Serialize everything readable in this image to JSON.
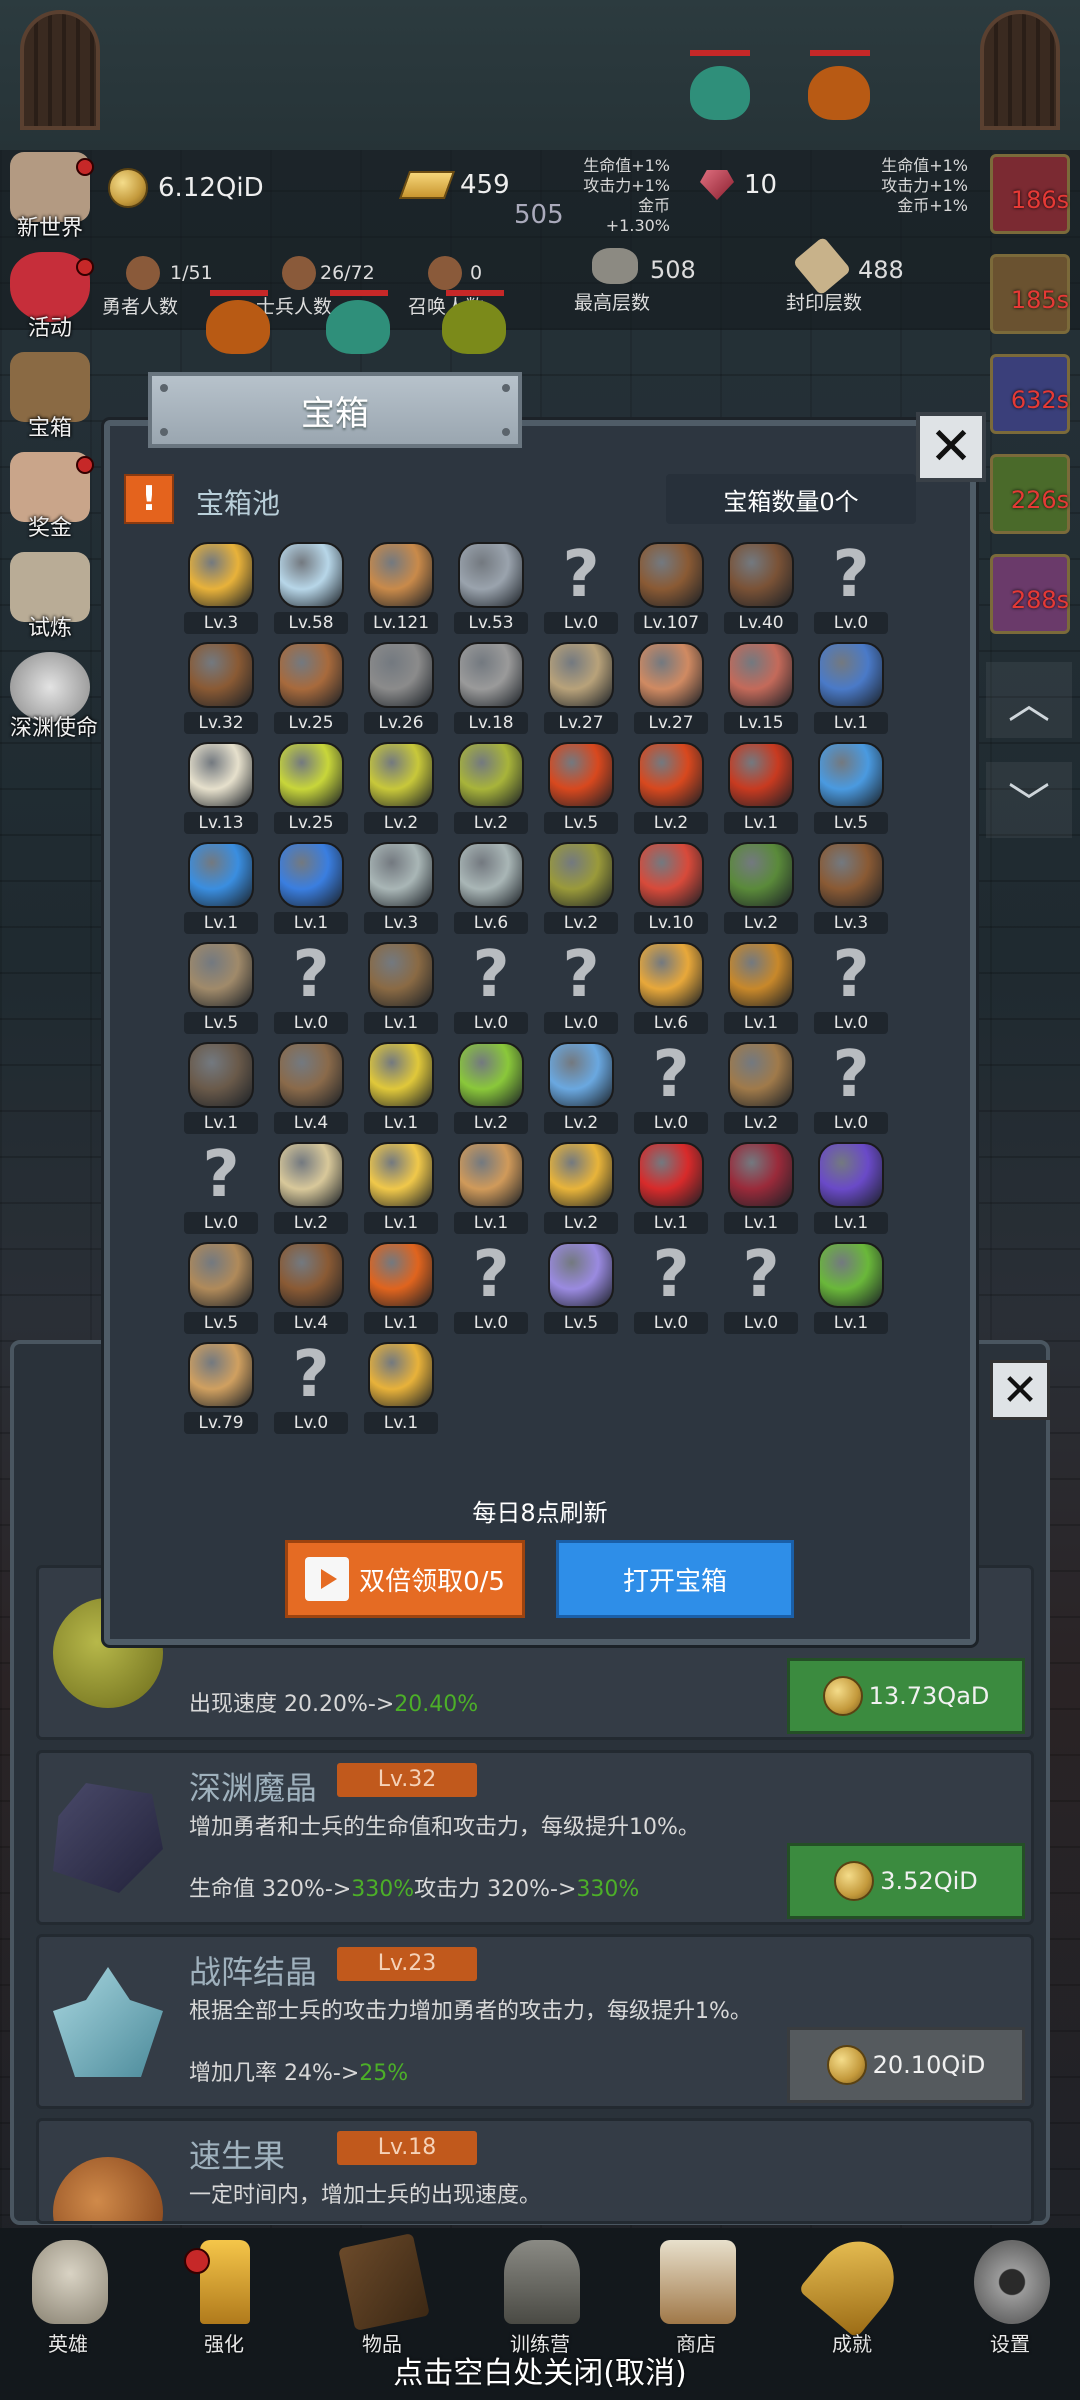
{
  "hud": {
    "gold": "6.12QiD",
    "goldbars": "459",
    "goldbar_sub": "505",
    "gems": "10",
    "bonus_left": [
      "生命值+1%",
      "攻击力+1%",
      "金币+1.30%"
    ],
    "bonus_right": [
      "生命值+1%",
      "攻击力+1%",
      "金币+1%"
    ],
    "heroes": {
      "value": "1/51",
      "label": "勇者人数"
    },
    "soldiers": {
      "value": "26/72",
      "label": "士兵人数"
    },
    "summons": {
      "value": "0",
      "label": "召唤人数"
    },
    "max_floor": {
      "value": "508",
      "label": "最高层数"
    },
    "sealed_floor": {
      "value": "488",
      "label": "封印层数"
    }
  },
  "left_menu": [
    "新世界",
    "活动",
    "宝箱",
    "奖金",
    "试炼",
    "深渊使命"
  ],
  "right_timers": [
    "186s",
    "185s",
    "632s",
    "226s",
    "288s"
  ],
  "modal": {
    "title": "宝箱",
    "pool_name": "宝箱池",
    "chest_count": "宝箱数量0个",
    "refresh_text": "每日8点刷新",
    "double_button": "双倍领取0/5",
    "open_button": "打开宝箱",
    "close_icon": "close-icon"
  },
  "items": [
    {
      "icon": "crown",
      "level": "Lv.3"
    },
    {
      "icon": "diamond",
      "level": "Lv.58"
    },
    {
      "icon": "bronze-sword",
      "level": "Lv.121"
    },
    {
      "icon": "iron-sword",
      "level": "Lv.53"
    },
    {
      "icon": "unknown",
      "level": "Lv.0"
    },
    {
      "icon": "leather-armor",
      "level": "Lv.107"
    },
    {
      "icon": "leather-vest",
      "level": "Lv.40"
    },
    {
      "icon": "unknown",
      "level": "Lv.0"
    },
    {
      "icon": "leather-helmet",
      "level": "Lv.32"
    },
    {
      "icon": "dagger",
      "level": "Lv.25"
    },
    {
      "icon": "knight-helmet",
      "level": "Lv.26"
    },
    {
      "icon": "hammer",
      "level": "Lv.18"
    },
    {
      "icon": "great-helm",
      "level": "Lv.27"
    },
    {
      "icon": "ham",
      "level": "Lv.27"
    },
    {
      "icon": "steak",
      "level": "Lv.15"
    },
    {
      "icon": "blue-sack",
      "level": "Lv.1"
    },
    {
      "icon": "flour-bowl",
      "level": "Lv.13"
    },
    {
      "icon": "yellow-potion",
      "level": "Lv.25"
    },
    {
      "icon": "yellow-flask",
      "level": "Lv.2"
    },
    {
      "icon": "olive-potion",
      "level": "Lv.2"
    },
    {
      "icon": "red-potion",
      "level": "Lv.5"
    },
    {
      "icon": "red-flask",
      "level": "Lv.2"
    },
    {
      "icon": "red-potion-big",
      "level": "Lv.1"
    },
    {
      "icon": "blue-potion",
      "level": "Lv.5"
    },
    {
      "icon": "blue-flask",
      "level": "Lv.1"
    },
    {
      "icon": "blue-potion-round",
      "level": "Lv.1"
    },
    {
      "icon": "gray-vial",
      "level": "Lv.3"
    },
    {
      "icon": "gray-vial-2",
      "level": "Lv.6"
    },
    {
      "icon": "olive-bottle",
      "level": "Lv.2"
    },
    {
      "icon": "red-vial",
      "level": "Lv.10"
    },
    {
      "icon": "winged-boot",
      "level": "Lv.2"
    },
    {
      "icon": "brown-boot",
      "level": "Lv.3"
    },
    {
      "icon": "boot",
      "level": "Lv.5"
    },
    {
      "icon": "unknown",
      "level": "Lv.0"
    },
    {
      "icon": "wooden-staff",
      "level": "Lv.1"
    },
    {
      "icon": "unknown",
      "level": "Lv.0"
    },
    {
      "icon": "unknown",
      "level": "Lv.0"
    },
    {
      "icon": "fire-staff",
      "level": "Lv.6"
    },
    {
      "icon": "torch-staff",
      "level": "Lv.1"
    },
    {
      "icon": "unknown",
      "level": "Lv.0"
    },
    {
      "icon": "pickaxe",
      "level": "Lv.1"
    },
    {
      "icon": "crook-staff",
      "level": "Lv.4"
    },
    {
      "icon": "lemons",
      "level": "Lv.1"
    },
    {
      "icon": "limes",
      "level": "Lv.2"
    },
    {
      "icon": "blue-wand",
      "level": "Lv.2"
    },
    {
      "icon": "unknown",
      "level": "Lv.0"
    },
    {
      "icon": "backpack",
      "level": "Lv.2"
    },
    {
      "icon": "unknown",
      "level": "Lv.0"
    },
    {
      "icon": "unknown",
      "level": "Lv.0"
    },
    {
      "icon": "spiked-club",
      "level": "Lv.2"
    },
    {
      "icon": "cheese",
      "level": "Lv.1"
    },
    {
      "icon": "pie",
      "level": "Lv.1"
    },
    {
      "icon": "honey-jar",
      "level": "Lv.2"
    },
    {
      "icon": "red-orb",
      "level": "Lv.1"
    },
    {
      "icon": "crystal",
      "level": "Lv.1"
    },
    {
      "icon": "gem-box",
      "level": "Lv.1"
    },
    {
      "icon": "bow",
      "level": "Lv.5"
    },
    {
      "icon": "quiver",
      "level": "Lv.4"
    },
    {
      "icon": "flame-shield",
      "level": "Lv.1"
    },
    {
      "icon": "unknown",
      "level": "Lv.0"
    },
    {
      "icon": "spirit",
      "level": "Lv.5"
    },
    {
      "icon": "unknown",
      "level": "Lv.0"
    },
    {
      "icon": "unknown",
      "level": "Lv.0"
    },
    {
      "icon": "green-wand",
      "level": "Lv.1"
    },
    {
      "icon": "beer-mug",
      "level": "Lv.79"
    },
    {
      "icon": "unknown",
      "level": "Lv.0"
    },
    {
      "icon": "gold-pickaxe",
      "level": "Lv.1"
    }
  ],
  "upgrades": [
    {
      "effect_prefix": "出现速度 20.20%->",
      "effect_new": "20.40%",
      "price": "13.73QaD"
    },
    {
      "title": "深渊魔晶",
      "level": "Lv.32",
      "desc": "增加勇者和士兵的生命值和攻击力，每级提升10%。",
      "effect_prefix": "生命值 320%->",
      "effect_new": "330%",
      "effect_prefix2": "攻击力 320%->",
      "effect_new2": "330%",
      "price": "3.52QiD"
    },
    {
      "title": "战阵结晶",
      "level": "Lv.23",
      "desc": "根据全部士兵的攻击力增加勇者的攻击力，每级提升1%。",
      "effect_prefix": "增加几率 24%->",
      "effect_new": "25%",
      "price": "20.10QiD"
    },
    {
      "title": "速生果",
      "level": "Lv.18",
      "desc": "一定时间内，增加士兵的出现速度。"
    }
  ],
  "bottom_nav": [
    "英雄",
    "强化",
    "物品",
    "训练营",
    "商店",
    "成就",
    "设置"
  ],
  "close_hint": "点击空白处关闭(取消)"
}
